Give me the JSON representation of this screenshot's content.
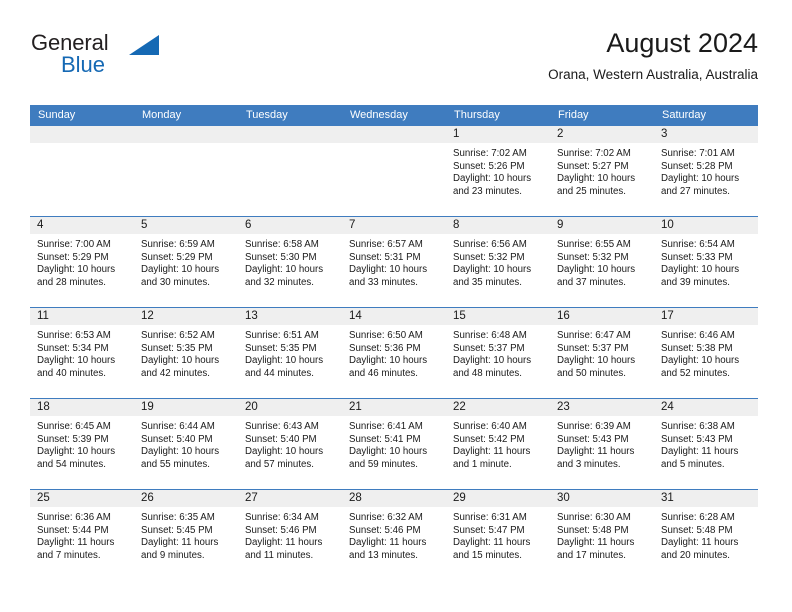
{
  "brand": {
    "name_dark": "General",
    "name_blue": "Blue",
    "triangle_icon": "blue-triangle-icon",
    "accent_color": "#1569b4"
  },
  "header": {
    "title": "August 2024",
    "subtitle": "Orana, Western Australia, Australia"
  },
  "theme": {
    "header_blue": "#3f7cbf",
    "day_band_gray": "#efefef",
    "text_color": "#1a1a1a"
  },
  "calendar": {
    "weekday_headers": [
      "Sunday",
      "Monday",
      "Tuesday",
      "Wednesday",
      "Thursday",
      "Friday",
      "Saturday"
    ],
    "weeks": [
      [
        {
          "day": "",
          "sunrise": "",
          "sunset": "",
          "daylight": "",
          "empty": true
        },
        {
          "day": "",
          "sunrise": "",
          "sunset": "",
          "daylight": "",
          "empty": true
        },
        {
          "day": "",
          "sunrise": "",
          "sunset": "",
          "daylight": "",
          "empty": true
        },
        {
          "day": "",
          "sunrise": "",
          "sunset": "",
          "daylight": "",
          "empty": true
        },
        {
          "day": "1",
          "sunrise": "Sunrise: 7:02 AM",
          "sunset": "Sunset: 5:26 PM",
          "daylight": "Daylight: 10 hours and 23 minutes."
        },
        {
          "day": "2",
          "sunrise": "Sunrise: 7:02 AM",
          "sunset": "Sunset: 5:27 PM",
          "daylight": "Daylight: 10 hours and 25 minutes."
        },
        {
          "day": "3",
          "sunrise": "Sunrise: 7:01 AM",
          "sunset": "Sunset: 5:28 PM",
          "daylight": "Daylight: 10 hours and 27 minutes."
        }
      ],
      [
        {
          "day": "4",
          "sunrise": "Sunrise: 7:00 AM",
          "sunset": "Sunset: 5:29 PM",
          "daylight": "Daylight: 10 hours and 28 minutes."
        },
        {
          "day": "5",
          "sunrise": "Sunrise: 6:59 AM",
          "sunset": "Sunset: 5:29 PM",
          "daylight": "Daylight: 10 hours and 30 minutes."
        },
        {
          "day": "6",
          "sunrise": "Sunrise: 6:58 AM",
          "sunset": "Sunset: 5:30 PM",
          "daylight": "Daylight: 10 hours and 32 minutes."
        },
        {
          "day": "7",
          "sunrise": "Sunrise: 6:57 AM",
          "sunset": "Sunset: 5:31 PM",
          "daylight": "Daylight: 10 hours and 33 minutes."
        },
        {
          "day": "8",
          "sunrise": "Sunrise: 6:56 AM",
          "sunset": "Sunset: 5:32 PM",
          "daylight": "Daylight: 10 hours and 35 minutes."
        },
        {
          "day": "9",
          "sunrise": "Sunrise: 6:55 AM",
          "sunset": "Sunset: 5:32 PM",
          "daylight": "Daylight: 10 hours and 37 minutes."
        },
        {
          "day": "10",
          "sunrise": "Sunrise: 6:54 AM",
          "sunset": "Sunset: 5:33 PM",
          "daylight": "Daylight: 10 hours and 39 minutes."
        }
      ],
      [
        {
          "day": "11",
          "sunrise": "Sunrise: 6:53 AM",
          "sunset": "Sunset: 5:34 PM",
          "daylight": "Daylight: 10 hours and 40 minutes."
        },
        {
          "day": "12",
          "sunrise": "Sunrise: 6:52 AM",
          "sunset": "Sunset: 5:35 PM",
          "daylight": "Daylight: 10 hours and 42 minutes."
        },
        {
          "day": "13",
          "sunrise": "Sunrise: 6:51 AM",
          "sunset": "Sunset: 5:35 PM",
          "daylight": "Daylight: 10 hours and 44 minutes."
        },
        {
          "day": "14",
          "sunrise": "Sunrise: 6:50 AM",
          "sunset": "Sunset: 5:36 PM",
          "daylight": "Daylight: 10 hours and 46 minutes."
        },
        {
          "day": "15",
          "sunrise": "Sunrise: 6:48 AM",
          "sunset": "Sunset: 5:37 PM",
          "daylight": "Daylight: 10 hours and 48 minutes."
        },
        {
          "day": "16",
          "sunrise": "Sunrise: 6:47 AM",
          "sunset": "Sunset: 5:37 PM",
          "daylight": "Daylight: 10 hours and 50 minutes."
        },
        {
          "day": "17",
          "sunrise": "Sunrise: 6:46 AM",
          "sunset": "Sunset: 5:38 PM",
          "daylight": "Daylight: 10 hours and 52 minutes."
        }
      ],
      [
        {
          "day": "18",
          "sunrise": "Sunrise: 6:45 AM",
          "sunset": "Sunset: 5:39 PM",
          "daylight": "Daylight: 10 hours and 54 minutes."
        },
        {
          "day": "19",
          "sunrise": "Sunrise: 6:44 AM",
          "sunset": "Sunset: 5:40 PM",
          "daylight": "Daylight: 10 hours and 55 minutes."
        },
        {
          "day": "20",
          "sunrise": "Sunrise: 6:43 AM",
          "sunset": "Sunset: 5:40 PM",
          "daylight": "Daylight: 10 hours and 57 minutes."
        },
        {
          "day": "21",
          "sunrise": "Sunrise: 6:41 AM",
          "sunset": "Sunset: 5:41 PM",
          "daylight": "Daylight: 10 hours and 59 minutes."
        },
        {
          "day": "22",
          "sunrise": "Sunrise: 6:40 AM",
          "sunset": "Sunset: 5:42 PM",
          "daylight": "Daylight: 11 hours and 1 minute."
        },
        {
          "day": "23",
          "sunrise": "Sunrise: 6:39 AM",
          "sunset": "Sunset: 5:43 PM",
          "daylight": "Daylight: 11 hours and 3 minutes."
        },
        {
          "day": "24",
          "sunrise": "Sunrise: 6:38 AM",
          "sunset": "Sunset: 5:43 PM",
          "daylight": "Daylight: 11 hours and 5 minutes."
        }
      ],
      [
        {
          "day": "25",
          "sunrise": "Sunrise: 6:36 AM",
          "sunset": "Sunset: 5:44 PM",
          "daylight": "Daylight: 11 hours and 7 minutes."
        },
        {
          "day": "26",
          "sunrise": "Sunrise: 6:35 AM",
          "sunset": "Sunset: 5:45 PM",
          "daylight": "Daylight: 11 hours and 9 minutes."
        },
        {
          "day": "27",
          "sunrise": "Sunrise: 6:34 AM",
          "sunset": "Sunset: 5:46 PM",
          "daylight": "Daylight: 11 hours and 11 minutes."
        },
        {
          "day": "28",
          "sunrise": "Sunrise: 6:32 AM",
          "sunset": "Sunset: 5:46 PM",
          "daylight": "Daylight: 11 hours and 13 minutes."
        },
        {
          "day": "29",
          "sunrise": "Sunrise: 6:31 AM",
          "sunset": "Sunset: 5:47 PM",
          "daylight": "Daylight: 11 hours and 15 minutes."
        },
        {
          "day": "30",
          "sunrise": "Sunrise: 6:30 AM",
          "sunset": "Sunset: 5:48 PM",
          "daylight": "Daylight: 11 hours and 17 minutes."
        },
        {
          "day": "31",
          "sunrise": "Sunrise: 6:28 AM",
          "sunset": "Sunset: 5:48 PM",
          "daylight": "Daylight: 11 hours and 20 minutes."
        }
      ]
    ]
  }
}
